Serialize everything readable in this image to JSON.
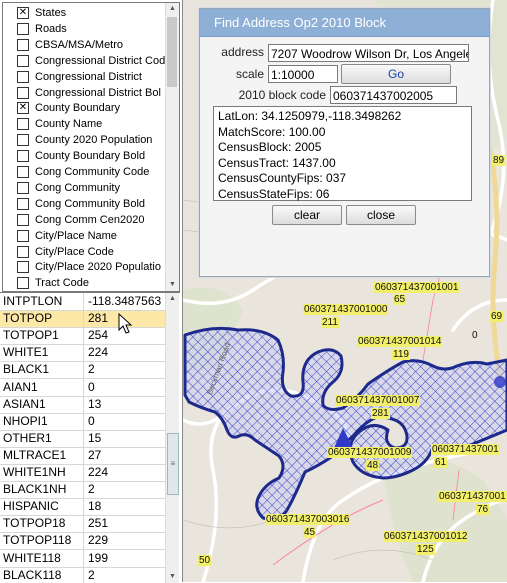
{
  "layers": [
    {
      "label": "States",
      "checked": true
    },
    {
      "label": "Roads",
      "checked": false
    },
    {
      "label": "CBSA/MSA/Metro",
      "checked": false
    },
    {
      "label": "Congressional District Cod",
      "checked": false
    },
    {
      "label": "Congressional District",
      "checked": false
    },
    {
      "label": "Congressional District Bol",
      "checked": false
    },
    {
      "label": "County Boundary",
      "checked": true
    },
    {
      "label": "County Name",
      "checked": false
    },
    {
      "label": "County 2020 Population",
      "checked": false
    },
    {
      "label": "County Boundary Bold",
      "checked": false
    },
    {
      "label": "Cong Community Code",
      "checked": false
    },
    {
      "label": "Cong Community",
      "checked": false
    },
    {
      "label": "Cong Community Bold",
      "checked": false
    },
    {
      "label": "Cong Comm Cen2020",
      "checked": false
    },
    {
      "label": "City/Place Name",
      "checked": false
    },
    {
      "label": "City/Place Code",
      "checked": false
    },
    {
      "label": "City/Place 2020 Populatio",
      "checked": false
    },
    {
      "label": "Tract Code",
      "checked": false
    }
  ],
  "attributes": [
    {
      "key": "INTPTLON",
      "value": "-118.3487563"
    },
    {
      "key": "TOTPOP",
      "value": "281"
    },
    {
      "key": "TOTPOP1",
      "value": "254"
    },
    {
      "key": "WHITE1",
      "value": "224"
    },
    {
      "key": "BLACK1",
      "value": "2"
    },
    {
      "key": "AIAN1",
      "value": "0"
    },
    {
      "key": "ASIAN1",
      "value": "13"
    },
    {
      "key": "NHOPI1",
      "value": "0"
    },
    {
      "key": "OTHER1",
      "value": "15"
    },
    {
      "key": "MLTRACE1",
      "value": "27"
    },
    {
      "key": "WHITE1NH",
      "value": "224"
    },
    {
      "key": "BLACK1NH",
      "value": "2"
    },
    {
      "key": "HISPANIC",
      "value": "18"
    },
    {
      "key": "TOTPOP18",
      "value": "251"
    },
    {
      "key": "TOTPOP118",
      "value": "229"
    },
    {
      "key": "WHITE118",
      "value": "199"
    },
    {
      "key": "BLACK118",
      "value": "2"
    }
  ],
  "dialog": {
    "title": "Find Address Op2 2010 Block",
    "address_label": "address",
    "address_value": "7207 Woodrow Wilson Dr, Los Angeles",
    "scale_label": "scale",
    "scale_value": "1:10000",
    "go_label": "Go",
    "block_label": "2010 block code",
    "block_value": "060371437002005",
    "result_lines": [
      "LatLon: 34.1250979,-118.3498262",
      "MatchScore: 100.00",
      "CensusBlock: 2005",
      "CensusTract: 1437.00",
      "CensusCountyFips: 037",
      "CensusStateFips: 06"
    ],
    "clear_label": "clear",
    "close_label": "close"
  },
  "map_labels": {
    "l1": "060371437001001",
    "l1b": "65",
    "l2": "060371437001000",
    "l2b": "211",
    "l3": "060371437001014",
    "l3b": "119",
    "l4": "060371437001007",
    "l4b": "281",
    "l5": "060371437001009",
    "l5b": "48",
    "l6": "060371437001",
    "l6b": "61",
    "l7": "060371437001",
    "l7b": "76",
    "l8": "060371437003016",
    "l8b": "45",
    "l9": "060371437001012",
    "l9b": "125",
    "e1": "89",
    "e2": "69",
    "e3": "0",
    "e4": "50",
    "road1": "Beckman Road"
  },
  "colors": {
    "selection": "#fde8a8",
    "block_fill": "#2f39c9",
    "title_bar": "#8fb0d6"
  }
}
